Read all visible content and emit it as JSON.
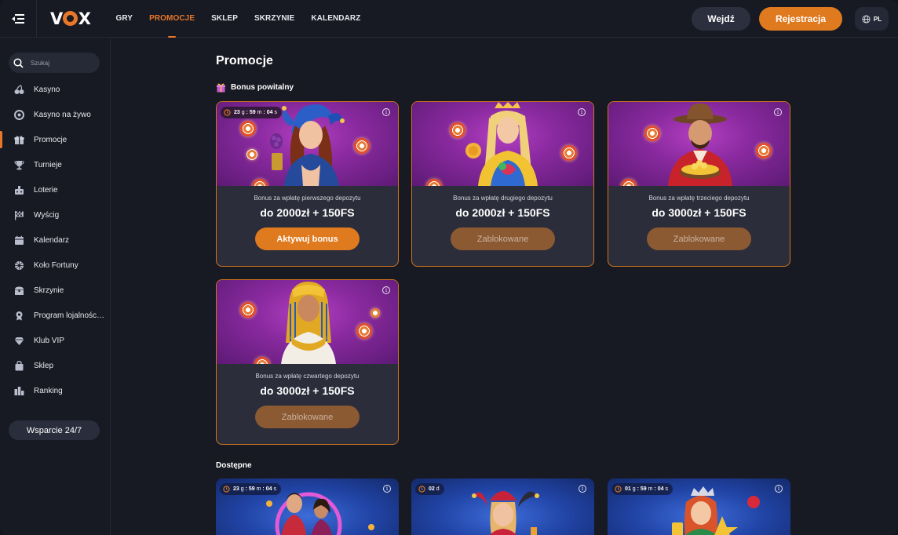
{
  "header": {
    "logo_text": "VOX",
    "nav": [
      {
        "label": "GRY",
        "active": false
      },
      {
        "label": "PROMOCJE",
        "active": true
      },
      {
        "label": "SKLEP",
        "active": false
      },
      {
        "label": "SKRZYNIE",
        "active": false
      },
      {
        "label": "KALENDARZ",
        "active": false
      }
    ],
    "login_label": "Wejdź",
    "register_label": "Rejestracja",
    "language": "PL"
  },
  "sidebar": {
    "search_placeholder": "Szukaj",
    "items": [
      {
        "label": "Kasyno",
        "icon": "cherries-icon"
      },
      {
        "label": "Kasyno na żywo",
        "icon": "chip-icon"
      },
      {
        "label": "Promocje",
        "icon": "gift-icon",
        "active": true
      },
      {
        "label": "Turnieje",
        "icon": "trophy-icon"
      },
      {
        "label": "Loterie",
        "icon": "lottery-icon"
      },
      {
        "label": "Wyścig",
        "icon": "race-flag-icon"
      },
      {
        "label": "Kalendarz",
        "icon": "calendar-icon"
      },
      {
        "label": "Koło Fortuny",
        "icon": "wheel-icon"
      },
      {
        "label": "Skrzynie",
        "icon": "chest-icon"
      },
      {
        "label": "Program lojalności…",
        "icon": "medal-icon"
      },
      {
        "label": "Klub VIP",
        "icon": "diamond-icon"
      },
      {
        "label": "Sklep",
        "icon": "bag-icon"
      },
      {
        "label": "Ranking",
        "icon": "ranking-icon"
      }
    ],
    "support_label": "Wsparcie 24/7"
  },
  "main": {
    "page_title": "Promocje",
    "welcome_section": "Bonus powitalny",
    "welcome_cards": [
      {
        "timer_days": "23",
        "timer_minutes": "59",
        "timer_seconds": "04",
        "subtitle": "Bonus za wpłatę pierwszego depozytu",
        "amount": "do 2000zł + 150FS",
        "cta": "Aktywuj bonus",
        "state": "active",
        "art": "jester-woman"
      },
      {
        "subtitle": "Bonus za wpłatę drugiego depozytu",
        "amount": "do 2000zł + 150FS",
        "cta": "Zablokowane",
        "state": "locked",
        "art": "queen"
      },
      {
        "subtitle": "Bonus za wpłatę trzeciego depozytu",
        "amount": "do 3000zł + 150FS",
        "cta": "Zablokowane",
        "state": "locked",
        "art": "cowboy"
      },
      {
        "subtitle": "Bonus za wpłatę czwartego depozytu",
        "amount": "do 3000zł + 150FS",
        "cta": "Zablokowane",
        "state": "locked",
        "art": "cleopatra"
      }
    ],
    "available_section": "Dostępne",
    "available_cards": [
      {
        "timer_days": "23",
        "timer_minutes": "59",
        "timer_seconds": "04",
        "art": "couple"
      },
      {
        "timer_days": "02",
        "art": "jester"
      },
      {
        "timer_days": "01",
        "timer_minutes": "59",
        "timer_seconds": "04",
        "art": "redhead"
      }
    ],
    "timer_units": {
      "days": "d",
      "hours": "g",
      "minutes": "m",
      "seconds": "s"
    }
  },
  "colors": {
    "accent": "#e07a1f",
    "locked": "#8b5a33",
    "background": "#181a23",
    "sidebar": "#171923"
  }
}
